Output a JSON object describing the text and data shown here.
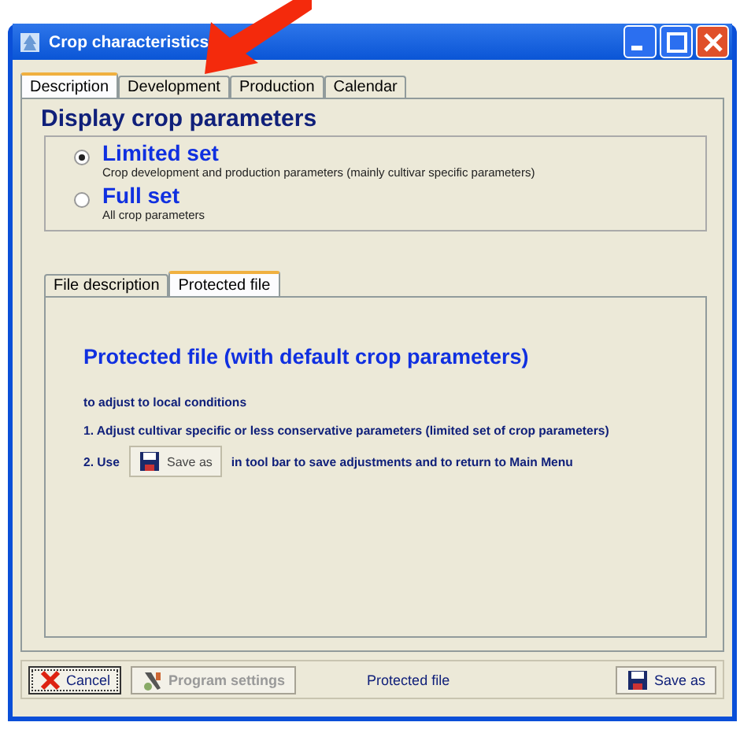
{
  "window": {
    "title": "Crop characteristics"
  },
  "tabs": [
    {
      "label": "Description",
      "selected": true
    },
    {
      "label": "Development",
      "selected": false
    },
    {
      "label": "Production",
      "selected": false
    },
    {
      "label": "Calendar",
      "selected": false
    }
  ],
  "heading": "Display crop parameters",
  "options": [
    {
      "label": "Limited set",
      "description": "Crop development and production parameters (mainly cultivar specific parameters)",
      "selected": true
    },
    {
      "label": "Full set",
      "description": "All crop parameters",
      "selected": false
    }
  ],
  "file_tabs": [
    {
      "label": "File description",
      "selected": false
    },
    {
      "label": "Protected file",
      "selected": true
    }
  ],
  "notice": {
    "title": "Protected file (with default crop parameters)",
    "intro": "to adjust to local conditions",
    "step_1": "1. Adjust cultivar specific or less conservative parameters (limited set of crop parameters)",
    "step_2_before": "2. Use",
    "step_2_button": "Save as",
    "step_2_after": "in tool bar to save adjustments and to return to Main Menu"
  },
  "toolbar": {
    "buttons": [
      {
        "kind": "cancel",
        "label": "Cancel",
        "disabled": false,
        "focused": true
      },
      {
        "kind": "settings",
        "label": "Program settings",
        "disabled": true,
        "focused": false
      }
    ],
    "status": "Protected file",
    "save_button": "Save as"
  }
}
